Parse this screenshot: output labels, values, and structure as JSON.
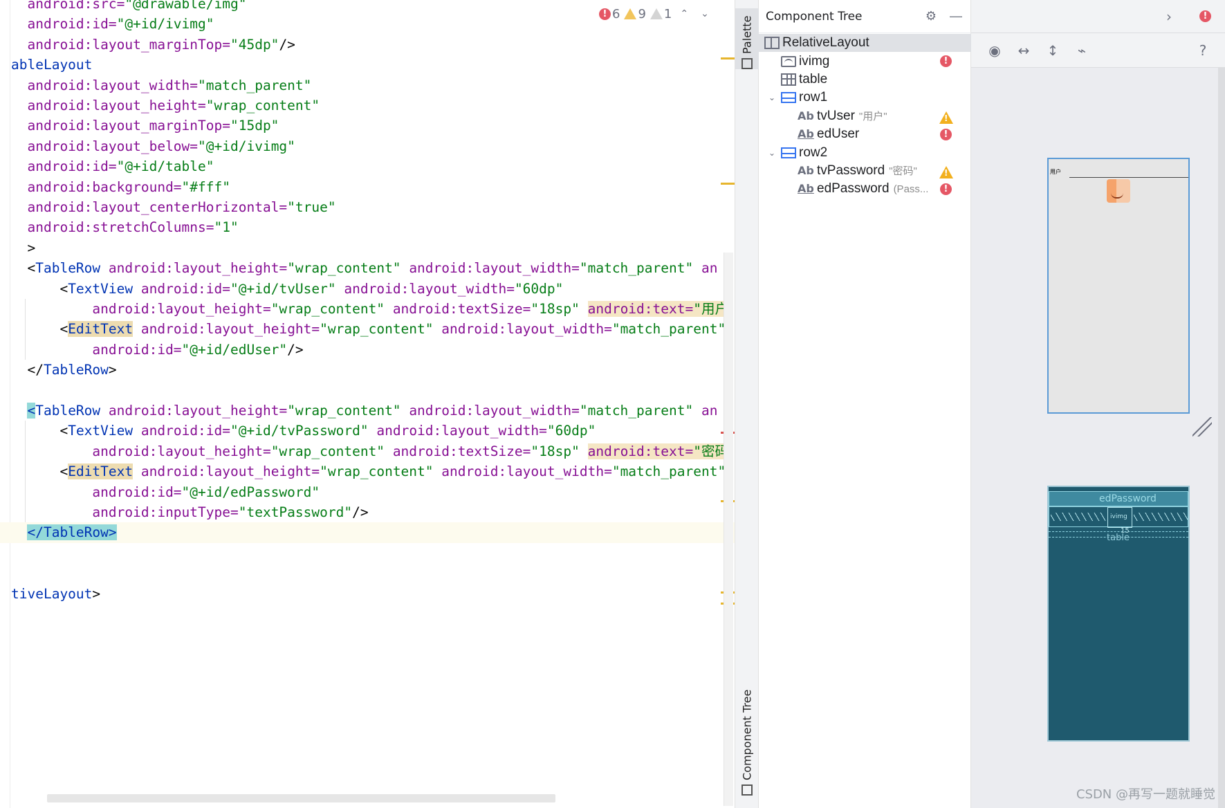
{
  "editor": {
    "lines": [
      {
        "indent": "  ",
        "parts": [
          [
            "attr",
            "android:src="
          ],
          [
            "val",
            "\"@drawable/img\""
          ]
        ]
      },
      {
        "indent": "  ",
        "parts": [
          [
            "attr",
            "android:id="
          ],
          [
            "val",
            "\"@+id/ivimg\""
          ]
        ]
      },
      {
        "indent": "  ",
        "parts": [
          [
            "attr",
            "android:layout_marginTop="
          ],
          [
            "val",
            "\"45dp\""
          ],
          [
            "plain",
            "/>"
          ]
        ]
      },
      {
        "indent": "",
        "parts": [
          [
            "tag",
            "ableLayout"
          ]
        ]
      },
      {
        "indent": "  ",
        "parts": [
          [
            "attr",
            "android:layout_width="
          ],
          [
            "val",
            "\"match_parent\""
          ]
        ]
      },
      {
        "indent": "  ",
        "parts": [
          [
            "attr",
            "android:layout_height="
          ],
          [
            "val",
            "\"wrap_content\""
          ]
        ]
      },
      {
        "indent": "  ",
        "parts": [
          [
            "attr",
            "android:layout_marginTop="
          ],
          [
            "val",
            "\"15dp\""
          ]
        ]
      },
      {
        "indent": "  ",
        "parts": [
          [
            "attr",
            "android:layout_below="
          ],
          [
            "val",
            "\"@+id/ivimg\""
          ]
        ]
      },
      {
        "indent": "  ",
        "parts": [
          [
            "attr",
            "android:id="
          ],
          [
            "val",
            "\"@+id/table\""
          ]
        ]
      },
      {
        "indent": "  ",
        "parts": [
          [
            "attr",
            "android:background="
          ],
          [
            "val",
            "\"#fff\""
          ]
        ]
      },
      {
        "indent": "  ",
        "parts": [
          [
            "attr",
            "android:layout_centerHorizontal="
          ],
          [
            "val",
            "\"true\""
          ]
        ]
      },
      {
        "indent": "  ",
        "parts": [
          [
            "attr",
            "android:stretchColumns="
          ],
          [
            "val",
            "\"1\""
          ]
        ]
      },
      {
        "indent": "  ",
        "parts": [
          [
            "plain",
            ">"
          ]
        ]
      },
      {
        "indent": "  ",
        "parts": [
          [
            "plain",
            "<"
          ],
          [
            "tag",
            "TableRow"
          ],
          [
            "plain",
            " "
          ],
          [
            "attr",
            "android:layout_height="
          ],
          [
            "val",
            "\"wrap_content\""
          ],
          [
            "plain",
            " "
          ],
          [
            "attr",
            "android:layout_width="
          ],
          [
            "val",
            "\"match_parent\""
          ],
          [
            "plain",
            " "
          ],
          [
            "attr",
            "an"
          ]
        ]
      },
      {
        "indent": "      ",
        "parts": [
          [
            "plain",
            "<"
          ],
          [
            "tag",
            "TextView"
          ],
          [
            "plain",
            " "
          ],
          [
            "attr",
            "android:id="
          ],
          [
            "val",
            "\"@+id/tvUser\""
          ],
          [
            "plain",
            " "
          ],
          [
            "attr",
            "android:layout_width="
          ],
          [
            "val",
            "\"60dp\""
          ]
        ]
      },
      {
        "indent": "          ",
        "parts": [
          [
            "attr",
            "android:layout_height="
          ],
          [
            "val",
            "\"wrap_content\""
          ],
          [
            "plain",
            " "
          ],
          [
            "attr",
            "android:textSize="
          ],
          [
            "val",
            "\"18sp\""
          ],
          [
            "plain",
            " "
          ],
          [
            "attr-hl",
            "android:text="
          ],
          [
            "val-hl",
            "\"用户"
          ]
        ]
      },
      {
        "indent": "      ",
        "parts": [
          [
            "plain",
            "<"
          ],
          [
            "tag-hl",
            "EditText"
          ],
          [
            "plain",
            " "
          ],
          [
            "attr",
            "android:layout_height="
          ],
          [
            "val",
            "\"wrap_content\""
          ],
          [
            "plain",
            " "
          ],
          [
            "attr",
            "android:layout_width="
          ],
          [
            "val",
            "\"match_parent\""
          ]
        ]
      },
      {
        "indent": "          ",
        "parts": [
          [
            "attr",
            "android:id="
          ],
          [
            "val",
            "\"@+id/edUser\""
          ],
          [
            "plain",
            "/>"
          ]
        ]
      },
      {
        "indent": "  ",
        "parts": [
          [
            "plain",
            "</"
          ],
          [
            "tag",
            "TableRow"
          ],
          [
            "plain",
            ">"
          ]
        ]
      },
      {
        "indent": "",
        "parts": []
      },
      {
        "indent": "  ",
        "parts": [
          [
            "tag-match",
            "<"
          ],
          [
            "tag",
            "TableRow"
          ],
          [
            "plain",
            " "
          ],
          [
            "attr",
            "android:layout_height="
          ],
          [
            "val",
            "\"wrap_content\""
          ],
          [
            "plain",
            " "
          ],
          [
            "attr",
            "android:layout_width="
          ],
          [
            "val",
            "\"match_parent\""
          ],
          [
            "plain",
            " "
          ],
          [
            "attr",
            "an"
          ]
        ]
      },
      {
        "indent": "      ",
        "parts": [
          [
            "plain",
            "<"
          ],
          [
            "tag",
            "TextView"
          ],
          [
            "plain",
            " "
          ],
          [
            "attr",
            "android:id="
          ],
          [
            "val",
            "\"@+id/tvPassword\""
          ],
          [
            "plain",
            " "
          ],
          [
            "attr",
            "android:layout_width="
          ],
          [
            "val",
            "\"60dp\""
          ]
        ]
      },
      {
        "indent": "          ",
        "parts": [
          [
            "attr",
            "android:layout_height="
          ],
          [
            "val",
            "\"wrap_content\""
          ],
          [
            "plain",
            " "
          ],
          [
            "attr",
            "android:textSize="
          ],
          [
            "val",
            "\"18sp\""
          ],
          [
            "plain",
            " "
          ],
          [
            "attr-hl",
            "android:text="
          ],
          [
            "val-hl",
            "\"密码"
          ]
        ]
      },
      {
        "indent": "      ",
        "parts": [
          [
            "plain",
            "<"
          ],
          [
            "tag-hl",
            "EditText"
          ],
          [
            "plain",
            " "
          ],
          [
            "attr",
            "android:layout_height="
          ],
          [
            "val",
            "\"wrap_content\""
          ],
          [
            "plain",
            " "
          ],
          [
            "attr",
            "android:layout_width="
          ],
          [
            "val",
            "\"match_parent\""
          ]
        ]
      },
      {
        "indent": "          ",
        "parts": [
          [
            "attr",
            "android:id="
          ],
          [
            "val",
            "\"@+id/edPassword\""
          ]
        ]
      },
      {
        "indent": "          ",
        "parts": [
          [
            "attr",
            "android:inputType="
          ],
          [
            "val",
            "\"textPassword\""
          ],
          [
            "plain",
            "/>"
          ]
        ]
      },
      {
        "indent": "  ",
        "parts": [
          [
            "tag-match",
            "</"
          ],
          [
            "tag-match",
            "TableRow"
          ],
          [
            "tag-match",
            ">"
          ]
        ]
      },
      {
        "indent": "",
        "parts": []
      },
      {
        "indent": "",
        "parts": []
      },
      {
        "indent": "",
        "parts": [
          [
            "tag",
            "tiveLayout"
          ],
          [
            "plain",
            ">"
          ]
        ]
      }
    ],
    "current_line_index": 26
  },
  "inspections": {
    "errors": "6",
    "warnings": "9",
    "weak_warnings": "1",
    "up_glyph": "⌃",
    "down_glyph": "⌄"
  },
  "tool_strip": {
    "palette_label": "Palette",
    "component_tree_label": "Component Tree"
  },
  "component_tree": {
    "title": "Component Tree",
    "settings_icon": "⚙",
    "minimize_icon": "—",
    "items": [
      {
        "label": "RelativeLayout",
        "hint": "",
        "icon": "relative-layout-icon",
        "depth": 0,
        "expandable": false,
        "badge": "",
        "selected": true
      },
      {
        "label": "ivimg",
        "hint": "",
        "icon": "image-view-icon",
        "depth": 1,
        "expandable": false,
        "badge": "error",
        "selected": false
      },
      {
        "label": "table",
        "hint": "",
        "icon": "table-layout-icon",
        "depth": 1,
        "expandable": false,
        "badge": "",
        "selected": false
      },
      {
        "label": "row1",
        "hint": "",
        "icon": "table-row-icon",
        "depth": 1,
        "expandable": true,
        "badge": "",
        "selected": false
      },
      {
        "label": "tvUser",
        "hint": "\"用户\"",
        "icon": "text-view-icon",
        "depth": 2,
        "expandable": false,
        "badge": "warning",
        "selected": false
      },
      {
        "label": "edUser",
        "hint": "",
        "icon": "edit-text-icon",
        "depth": 2,
        "expandable": false,
        "badge": "error",
        "selected": false
      },
      {
        "label": "row2",
        "hint": "",
        "icon": "table-row-icon",
        "depth": 1,
        "expandable": true,
        "badge": "",
        "selected": false
      },
      {
        "label": "tvPassword",
        "hint": "\"密码\"",
        "icon": "text-view-icon",
        "depth": 2,
        "expandable": false,
        "badge": "warning",
        "selected": false
      },
      {
        "label": "edPassword",
        "hint": "(Pass...",
        "icon": "edit-text-icon",
        "depth": 2,
        "expandable": false,
        "badge": "error",
        "selected": false
      }
    ],
    "ab_glyph": "Ab",
    "chevron_down": "⌄"
  },
  "design": {
    "top_chevron": "›",
    "eye_icon": "◉",
    "h_arrows": "↔",
    "v_arrows": "↕",
    "magnet_icon": "⌁",
    "help": "?",
    "preview_label": "用户",
    "blueprint_row1_label": "edPassword",
    "blueprint_ivimg_label": "ivimg",
    "blueprint_margin_label": "15",
    "blueprint_table_label": "table"
  },
  "watermark": "CSDN @再写一题就睡觉",
  "colors": {
    "error": "#e55765",
    "warning": "#f2b01e",
    "attribute": "#871094",
    "string": "#067d17",
    "tag": "#0033b3",
    "blueprint": "#1f5a6e",
    "selection": "#dfe1e5"
  }
}
